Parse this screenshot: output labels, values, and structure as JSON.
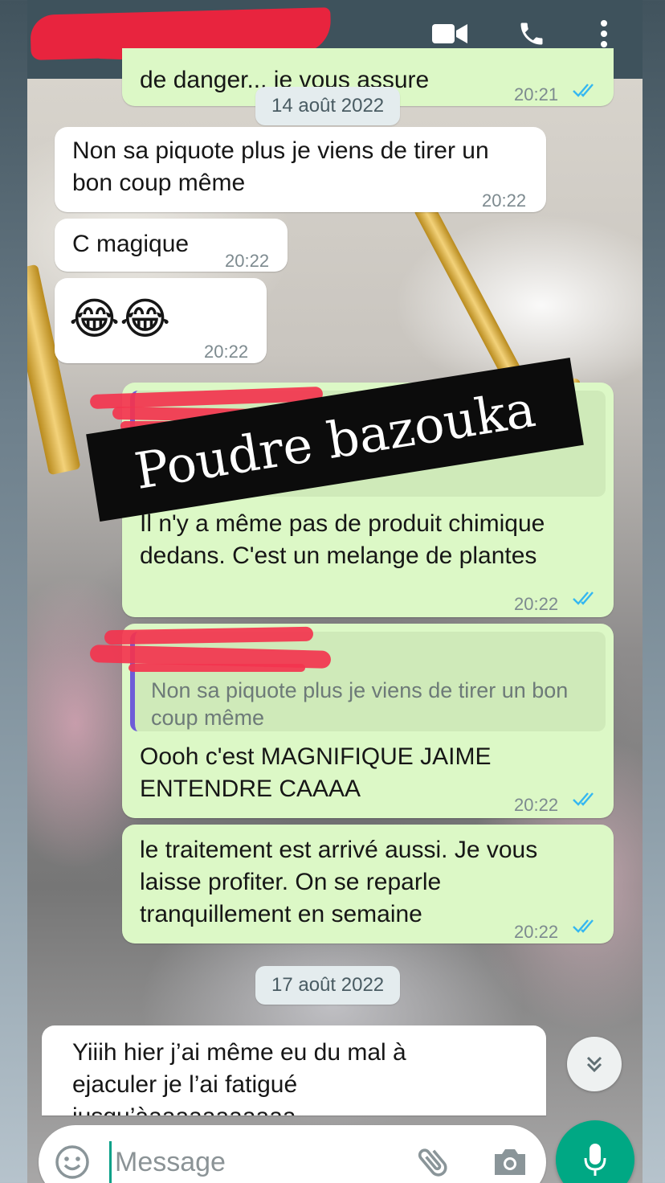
{
  "header": {
    "video_call_icon": "video-camera-icon",
    "voice_call_icon": "phone-icon",
    "menu_icon": "more-vertical-icon"
  },
  "messages": {
    "partial_top": {
      "text": "de danger... je vous assure",
      "time": "20:21"
    },
    "date_1": "14 août 2022",
    "m1": {
      "text": "Non sa piquote plus je viens de tirer un bon coup même",
      "time": "20:22"
    },
    "m2": {
      "text": "C magique",
      "time": "20:22"
    },
    "m3": {
      "text": "😂😂",
      "time": "20:22"
    },
    "m4": {
      "text": "Il n'y a même pas de produit chimique dedans. C'est un melange de plantes",
      "time": "20:22"
    },
    "m5": {
      "quote": "Non sa piquote plus je viens de tirer un bon coup même",
      "text": "Oooh c'est MAGNIFIQUE JAIME ENTENDRE CAAAA",
      "time": "20:22"
    },
    "m6": {
      "text": "le traitement est arrivé aussi. Je vous laisse profiter. On se reparle tranquillement en semaine",
      "time": "20:22"
    },
    "date_2": "17 août 2022",
    "m7": {
      "text": "Yiiih hier j’ai même eu du mal à ejaculer je l’ai fatigué jusqu’àaaaaaaaaaaa"
    }
  },
  "overlay": {
    "label": "Poudre bazouka"
  },
  "composer": {
    "placeholder": "Message",
    "emoji_icon": "emoji-icon",
    "attach_icon": "paperclip-icon",
    "camera_icon": "camera-icon",
    "mic_icon": "microphone-icon"
  },
  "colors": {
    "header": "#3e525c",
    "incoming_bubble": "#ffffff",
    "outgoing_bubble": "#dcf8c6",
    "read_ticks": "#34b7f1",
    "mic_button": "#00a884",
    "redaction": "#e8243e"
  }
}
